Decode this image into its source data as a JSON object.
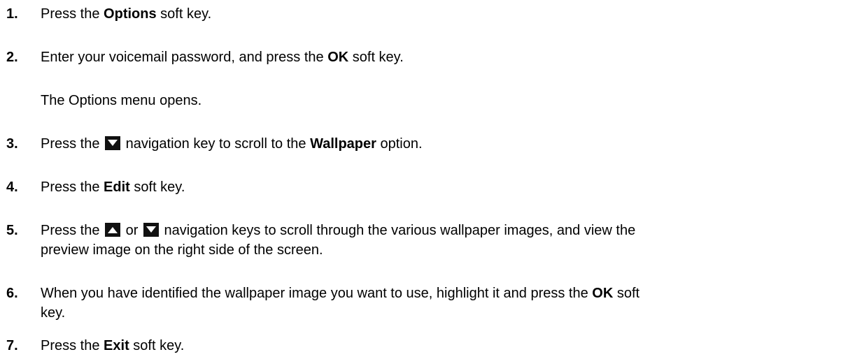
{
  "steps": [
    {
      "num": "1.",
      "pre": "Press the ",
      "bold": "Options",
      "post": " soft key."
    },
    {
      "num": "2.",
      "pre": "Enter your voicemail password, and press the ",
      "bold": "OK",
      "post": " soft key."
    },
    {
      "note": "The Options menu opens."
    },
    {
      "num": "3.",
      "pre": "Press the ",
      "icon": "down-arrow-key",
      "mid": " navigation key to scroll to the ",
      "bold": "Wallpaper",
      "post": " option."
    },
    {
      "num": "4.",
      "pre": "Press the ",
      "bold": "Edit",
      "post": " soft key."
    },
    {
      "num": "5.",
      "pre": "Press the ",
      "icon1": "up-arrow-key",
      "or": " or ",
      "icon2": "down-arrow-key",
      "post_line1": " navigation keys to scroll through the various wallpaper images, and view the",
      "line2": "preview image on the right side of the screen."
    },
    {
      "num": "6.",
      "line1_pre": "When you have identified the wallpaper image you want to use, highlight it and press the ",
      "bold": "OK",
      "line1_post": " soft",
      "line2": "key."
    },
    {
      "num": "7.",
      "pre": "Press the ",
      "bold": "Exit",
      "post": " soft key."
    }
  ]
}
